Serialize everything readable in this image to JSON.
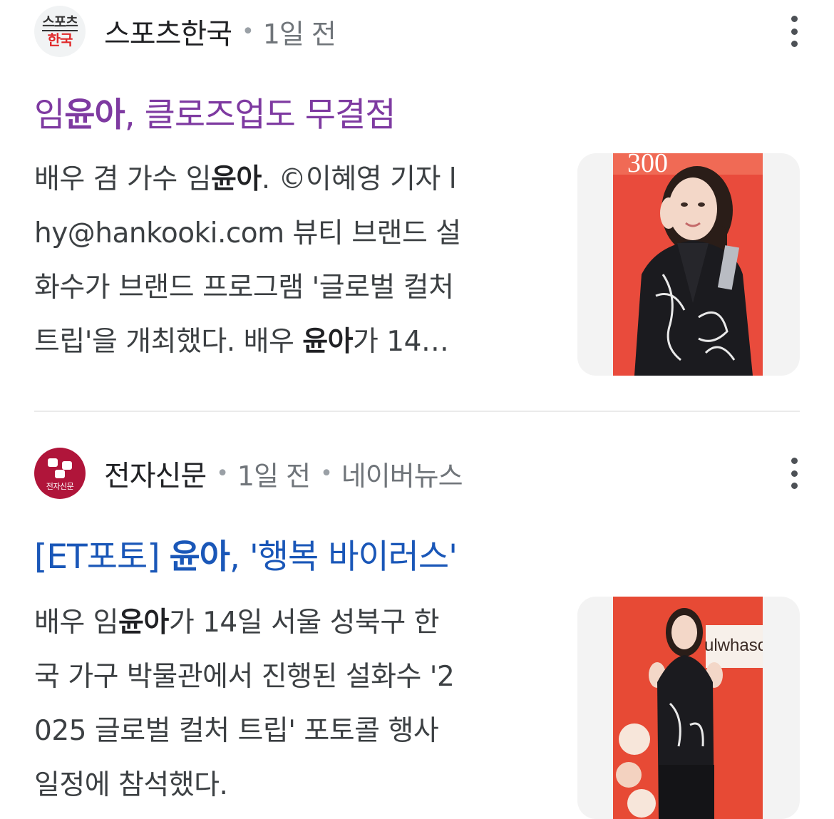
{
  "results": [
    {
      "source_name": "스포츠한국",
      "logo_text_top": "스포츠",
      "logo_text_bottom": "한국",
      "time": "1일 전",
      "headline_part1": "임",
      "headline_bold": "윤아",
      "headline_part2": ", 클로즈업도 무결점",
      "snippet_lines": [
        {
          "a": "배우 겸 가수 임",
          "b": "윤아",
          "c": ". ©이혜영 기자 l"
        },
        {
          "a": "hy@hankooki.com 뷰티 브랜드 설",
          "b": "",
          "c": ""
        },
        {
          "a": "화수가 브랜드 프로그램 '글로벌 컬처",
          "b": "",
          "c": ""
        },
        {
          "a": "트립'을 개최했다. 배우 ",
          "b": "윤아",
          "c": "가 14…"
        }
      ],
      "thumb_label": "woman in black jacket photo",
      "colors": {
        "headline": "#7e3aa1",
        "thumb_bg": "#e94b3c"
      }
    },
    {
      "source_name": "전자신문",
      "logo_text": "전자신문",
      "time": "1일 전",
      "aggregator": "네이버뉴스",
      "headline_part1": "[ET포토] ",
      "headline_bold": "윤아",
      "headline_part2": ", '행복 바이러스'",
      "snippet_lines": [
        {
          "a": "배우 임",
          "b": "윤아",
          "c": "가 14일 서울 성북구 한"
        },
        {
          "a": "국 가구 박물관에서 진행된 설화수 '2",
          "b": "",
          "c": ""
        },
        {
          "a": "025 글로벌 컬처 트립' 포토콜 행사",
          "b": "",
          "c": ""
        },
        {
          "a": "일정에 참석했다.",
          "b": "",
          "c": ""
        }
      ],
      "thumb_sign": "ulwhaso",
      "colors": {
        "headline": "#1a57b8",
        "thumb_bg": "#e74a35"
      }
    }
  ]
}
